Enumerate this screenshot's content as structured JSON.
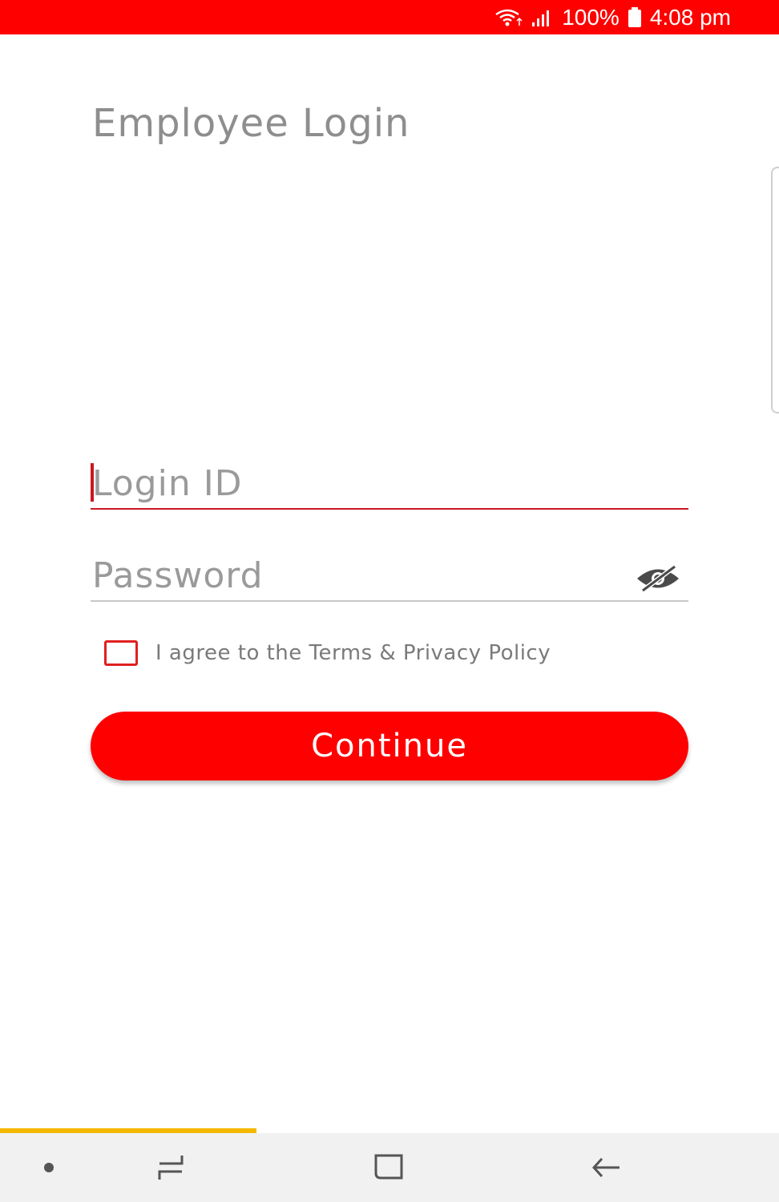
{
  "status_bar": {
    "battery_percent": "100%",
    "time": "4:08 pm",
    "bg_color": "#ff0000"
  },
  "login": {
    "title": "Employee Login",
    "login_id": {
      "placeholder": "Login ID",
      "value": ""
    },
    "password": {
      "placeholder": "Password",
      "value": "",
      "toggle_icon": "eye-off-icon"
    },
    "agree_text": "I agree to the Terms & Privacy Policy",
    "agree_checked": false,
    "continue_label": "Continue",
    "accent_color": "#ff0000"
  },
  "nav": {
    "icons": [
      "dot-icon",
      "recent-apps-icon",
      "home-icon",
      "back-icon"
    ]
  }
}
